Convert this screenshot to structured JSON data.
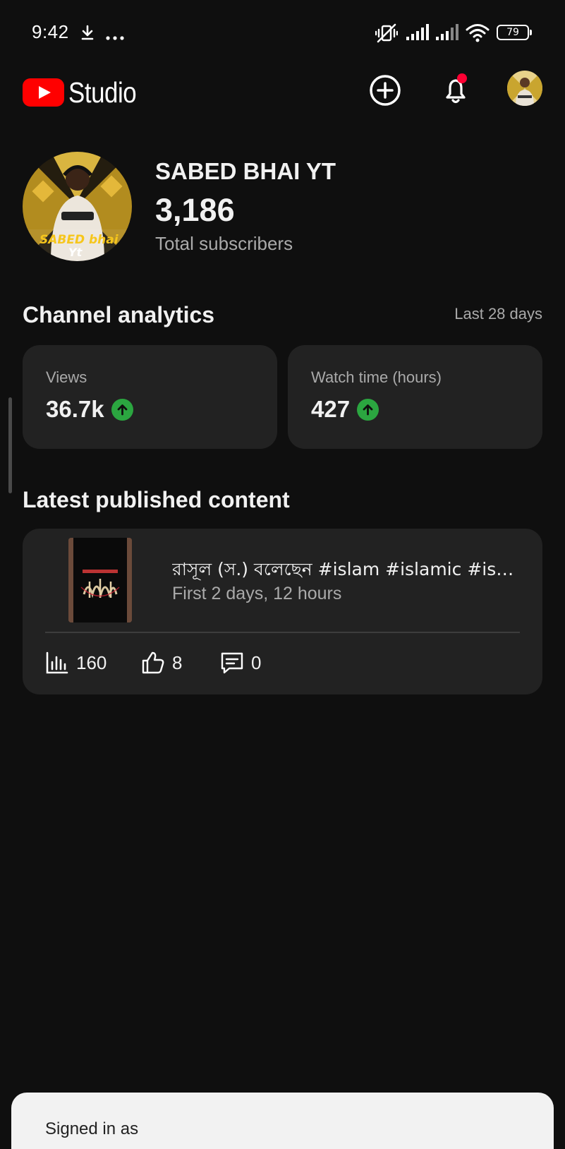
{
  "status_bar": {
    "time": "9:42",
    "battery": "79",
    "icons": [
      "download-icon",
      "more-dots-icon",
      "vibrate-off-icon",
      "signal-icon",
      "signal-icon",
      "wifi-icon",
      "battery-icon"
    ]
  },
  "app_bar": {
    "logo_text": "Studio",
    "icons": [
      "youtube-logo",
      "create-icon",
      "notifications-icon",
      "account-avatar"
    ]
  },
  "channel": {
    "name": "SABED BHAI YT",
    "subscribers": "3,186",
    "subscribers_label": "Total subscribers",
    "avatar_text_1": "SABED bhai",
    "avatar_text_2": "Yt"
  },
  "analytics": {
    "title": "Channel analytics",
    "period": "Last 28 days",
    "cards": [
      {
        "label": "Views",
        "value": "36.7k",
        "trend": "up"
      },
      {
        "label": "Watch time (hours)",
        "value": "427",
        "trend": "up"
      }
    ]
  },
  "latest": {
    "title": "Latest published content",
    "video_title": "রাসূল (স.) বলেছেন  #islam #islamic #islamicstatus",
    "video_subtitle": "First 2 days, 12 hours",
    "views": "160",
    "likes": "8",
    "comments": "0"
  },
  "bottom_sheet": {
    "signed_in": "Signed in as"
  },
  "colors": {
    "background": "#0f0f0f",
    "card": "#222222",
    "accent_red": "#ff0000",
    "trend_green": "#2ba640",
    "secondary_text": "#aaaaaa"
  }
}
